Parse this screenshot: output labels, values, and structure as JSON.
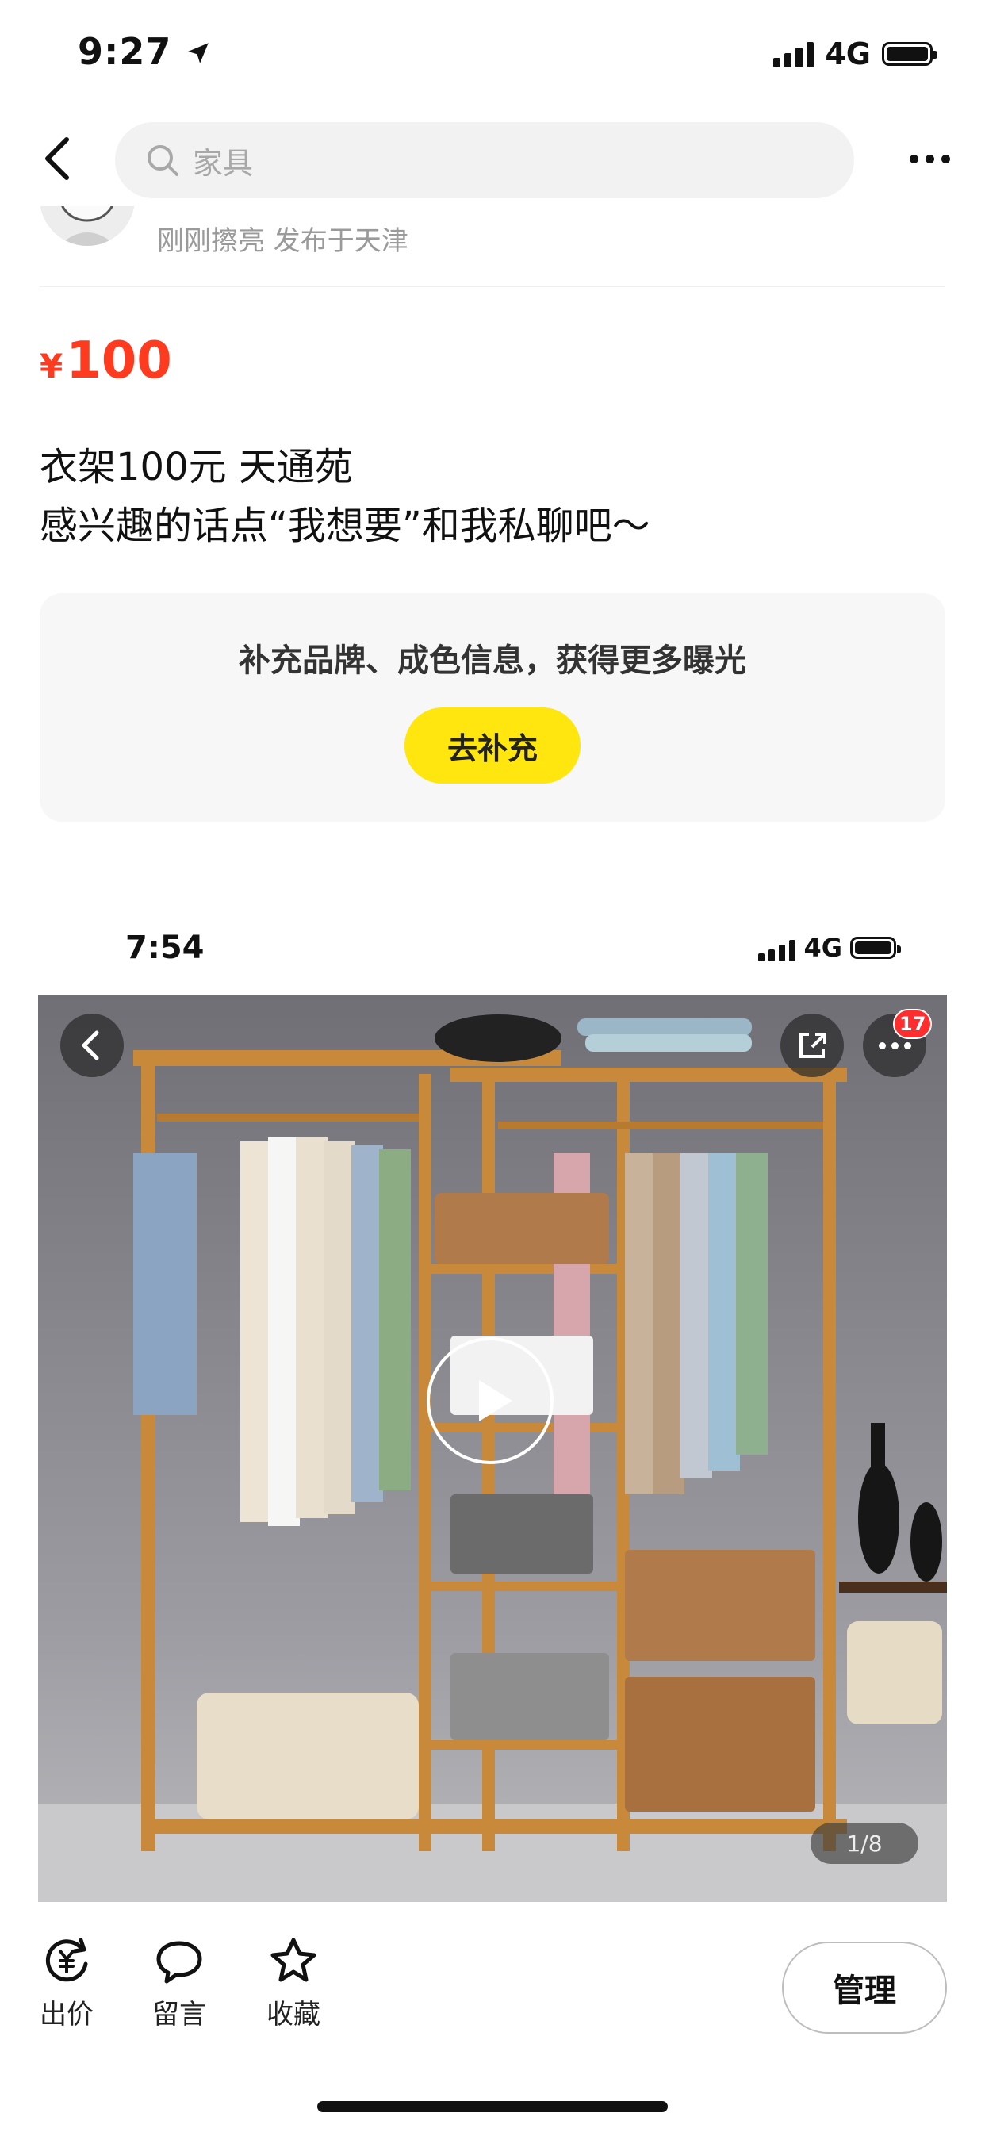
{
  "status_bar": {
    "time": "9:27",
    "network": "4G"
  },
  "nav": {
    "search_placeholder": "家具"
  },
  "seller": {
    "meta": "刚刚擦亮 发布于天津"
  },
  "price": {
    "currency": "¥",
    "value": "100",
    "color": "#ff3b1f"
  },
  "description": {
    "line1": "衣架100元 天通苑",
    "line2": "感兴趣的话点“我想要”和我私聊吧～"
  },
  "promo": {
    "text": "补充品牌、成色信息，获得更多曝光",
    "button_label": "去补充",
    "button_color": "#ffe60f"
  },
  "embedded_screenshot": {
    "time": "7:54",
    "network": "4G",
    "notification_count": "17",
    "image_counter": "1/8"
  },
  "bottom_bar": {
    "actions": [
      {
        "label": "出价",
        "icon": "yuan-circle-icon"
      },
      {
        "label": "留言",
        "icon": "chat-bubble-icon"
      },
      {
        "label": "收藏",
        "icon": "star-icon"
      }
    ],
    "manage_label": "管理"
  }
}
